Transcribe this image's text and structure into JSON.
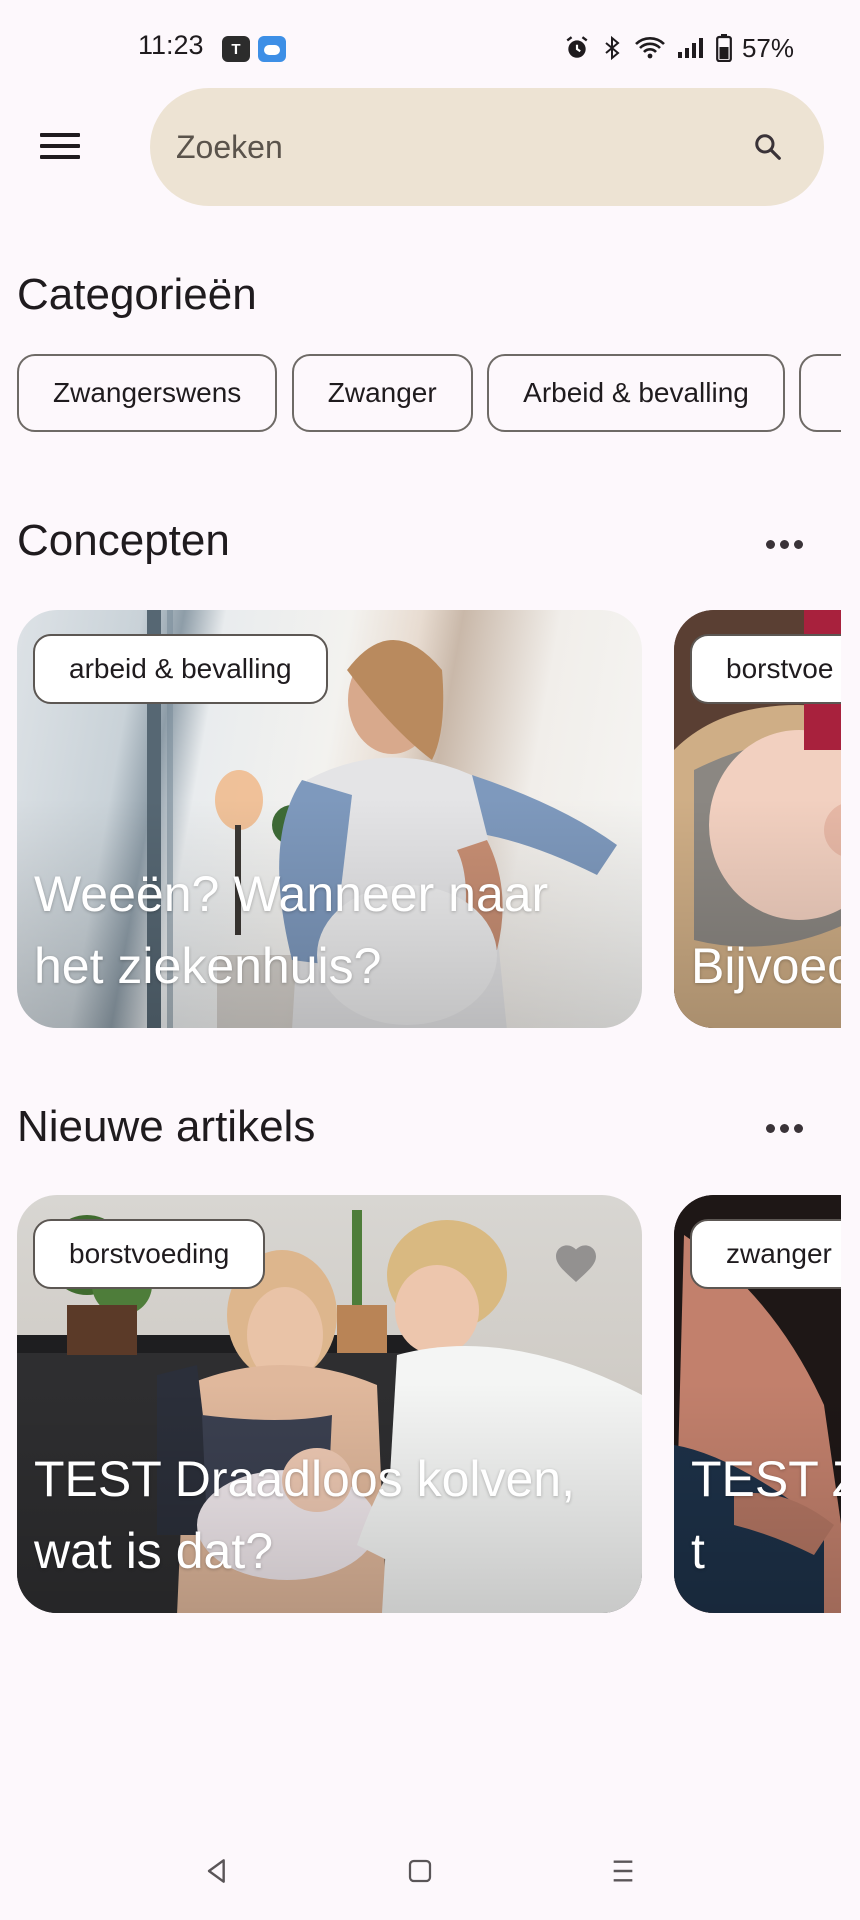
{
  "status_bar": {
    "time": "11:23",
    "battery": "57%",
    "icons": [
      "teams-icon",
      "weather-icon",
      "alarm-icon",
      "bluetooth-icon",
      "wifi-icon",
      "signal-icon",
      "battery-icon"
    ]
  },
  "top_bar": {
    "menu_icon": "hamburger-menu-icon",
    "search_placeholder": "Zoeken",
    "search_icon": "search-icon",
    "search_bg": "#EDE3D3"
  },
  "categories": {
    "title": "Categorieën",
    "chips": [
      "Zwangerswens",
      "Zwanger",
      "Arbeid & bevalling",
      ""
    ]
  },
  "concepts": {
    "title": "Concepten",
    "more_icon": "more-horizontal-icon",
    "cards": [
      {
        "tag": "arbeid & bevalling",
        "title": "Weeën? Wanneer naar het ziekenhuis?"
      },
      {
        "tag": "borstvoe",
        "title": "Bijvoec"
      }
    ]
  },
  "articles": {
    "title": "Nieuwe artikels",
    "more_icon": "more-horizontal-icon",
    "cards": [
      {
        "tag": "borstvoeding",
        "title": "TEST Draadloos kolven, wat is dat?",
        "favorite_icon": "heart-icon"
      },
      {
        "tag": "zwanger",
        "title": "TEST Z van A t"
      }
    ]
  },
  "nav_bar": {
    "icons": [
      "back-icon",
      "home-icon",
      "recents-icon"
    ]
  },
  "colors": {
    "background": "#FDF8FC",
    "chip_border": "#6E6A66",
    "text": "#1F1B1E"
  }
}
